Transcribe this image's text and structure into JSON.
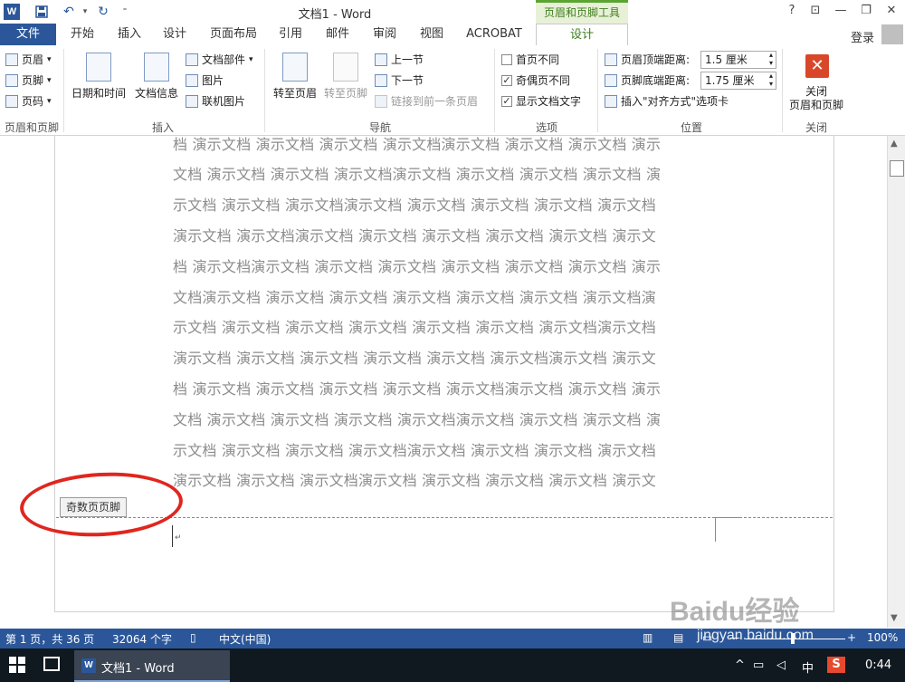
{
  "window": {
    "title": "文档1 - Word",
    "contextual_tool": "页眉和页脚工具",
    "help": "?",
    "ribbon_display": "⊡",
    "minimize": "—",
    "restore": "❐",
    "close": "✕"
  },
  "quick_access": {
    "save_icon": "save-icon",
    "undo_icon": "undo-icon",
    "redo_icon": "redo-icon"
  },
  "tabs": {
    "file": "文件",
    "items": [
      "开始",
      "插入",
      "设计",
      "页面布局",
      "引用",
      "邮件",
      "审阅",
      "视图",
      "ACROBAT"
    ],
    "active": "设计",
    "login": "登录"
  },
  "ribbon": {
    "group1": {
      "label": "页眉和页脚",
      "header": "页眉",
      "footer": "页脚",
      "page_number": "页码"
    },
    "group2": {
      "label": "插入",
      "datetime": "日期和时间",
      "docinfo": "文档信息",
      "doc_parts": "文档部件",
      "picture": "图片",
      "online_picture": "联机图片"
    },
    "group3": {
      "label": "导航",
      "goto_header": "转至页眉",
      "goto_footer": "转至页脚",
      "prev_section": "上一节",
      "next_section": "下一节",
      "link_prev": "链接到前一条页眉"
    },
    "group4": {
      "label": "选项",
      "first_page": "首页不同",
      "odd_even": "奇偶页不同",
      "show_text": "显示文档文字",
      "first_page_checked": false,
      "odd_even_checked": true,
      "show_text_checked": true
    },
    "group5": {
      "label": "位置",
      "header_top": "页眉顶端距离:",
      "header_top_value": "1.5 厘米",
      "footer_bottom": "页脚底端距离:",
      "footer_bottom_value": "1.75 厘米",
      "insert_align": "插入\"对齐方式\"选项卡"
    },
    "group6": {
      "label": "关闭",
      "close_line1": "关闭",
      "close_line2": "页眉和页脚"
    }
  },
  "document": {
    "lines": [
      "档 演示文档 演示文档 演示文档 演示文档演示文档 演示文档 演示文档 演示",
      "文档 演示文档 演示文档 演示文档演示文档 演示文档 演示文档 演示文档 演",
      "示文档 演示文档 演示文档演示文档 演示文档 演示文档 演示文档 演示文档",
      "演示文档 演示文档演示文档 演示文档 演示文档 演示文档 演示文档 演示文",
      "档 演示文档演示文档 演示文档 演示文档 演示文档 演示文档 演示文档 演示",
      "文档演示文档 演示文档 演示文档 演示文档 演示文档 演示文档 演示文档演",
      "示文档 演示文档 演示文档 演示文档 演示文档 演示文档 演示文档演示文档",
      "演示文档 演示文档 演示文档 演示文档 演示文档 演示文档演示文档 演示文",
      "档 演示文档 演示文档 演示文档 演示文档 演示文档演示文档 演示文档 演示",
      "文档 演示文档 演示文档 演示文档 演示文档演示文档 演示文档 演示文档 演",
      "示文档 演示文档 演示文档 演示文档演示文档 演示文档 演示文档 演示文档",
      "演示文档 演示文档 演示文档演示文档 演示文档 演示文档 演示文档 演示文"
    ],
    "footer_tag": "奇数页页脚",
    "para_mark": "↵",
    "highlight_color": "#e0261e"
  },
  "status": {
    "page": "第 1 页，共 36 页",
    "words": "32064 个字",
    "lang": "中文(中国)",
    "zoom": "100%"
  },
  "taskbar": {
    "word_task": "文档1 - Word",
    "ime": "中",
    "time": "0:44"
  },
  "watermark": {
    "logo": "Baidu经验",
    "url": "jingyan.baidu.com"
  },
  "colors": {
    "word_blue": "#2b579a",
    "tools_green": "#3d7f1d",
    "close_red": "#d9472b"
  }
}
